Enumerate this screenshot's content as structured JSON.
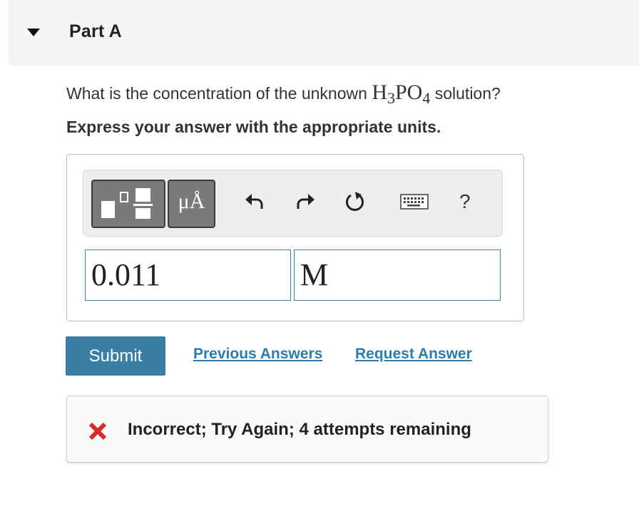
{
  "part": {
    "title": "Part A",
    "collapse_icon": "caret-down-icon"
  },
  "question": {
    "prefix": "What is the concentration of the unknown ",
    "formula_h": "H",
    "formula_h_sub": "3",
    "formula_po": "PO",
    "formula_po_sub": "4",
    "suffix": " solution?",
    "instruction": "Express your answer with the appropriate units."
  },
  "toolbar": {
    "templates_icon": "templates-icon",
    "units_label": "μÅ",
    "undo_icon": "undo-icon",
    "redo_icon": "redo-icon",
    "reset_icon": "reset-icon",
    "keyboard_icon": "keyboard-icon",
    "help_label": "?"
  },
  "answer": {
    "value": "0.011",
    "units": "M"
  },
  "actions": {
    "submit_label": "Submit",
    "previous_answers_label": "Previous Answers",
    "request_answer_label": "Request Answer"
  },
  "feedback": {
    "icon": "x-mark-icon",
    "message": "Incorrect; Try Again; 4 attempts remaining"
  },
  "colors": {
    "link": "#2f7ca9",
    "submit_bg": "#3a7fa3",
    "input_border": "#3a87b5",
    "error_red": "#d62b2b",
    "header_bg": "#f5f5f5"
  }
}
